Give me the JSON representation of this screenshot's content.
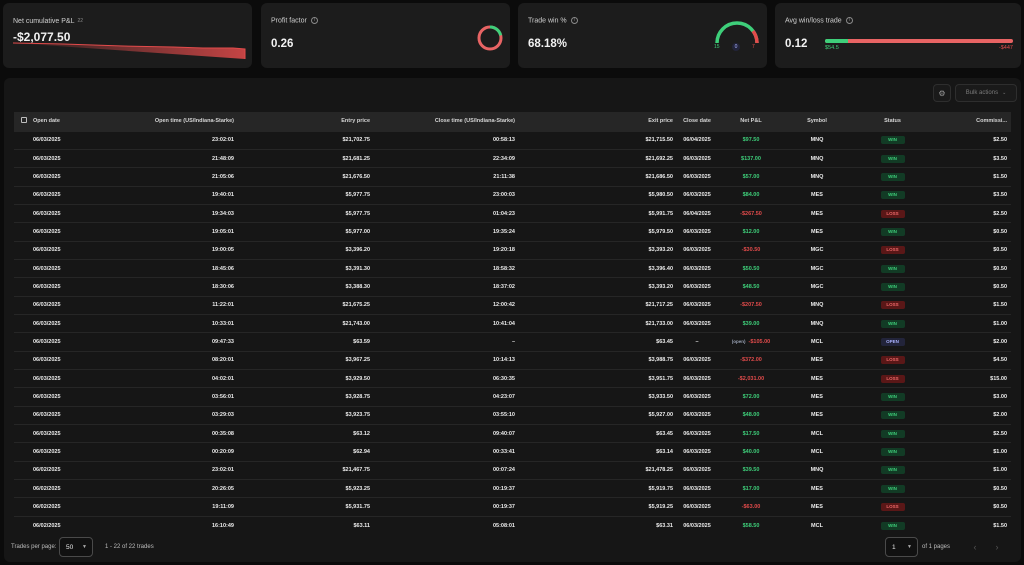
{
  "cards": {
    "net_pnl": {
      "label": "Net cumulative P&L",
      "count": "22",
      "value": "-$2,077.50"
    },
    "profit_factor": {
      "label": "Profit factor",
      "value": "0.26",
      "gauge_fraction": 0.21
    },
    "trade_win": {
      "label": "Trade win %",
      "value": "68.18%",
      "wins": "15",
      "breakeven": "0",
      "losses": "7"
    },
    "avg_win_loss": {
      "label": "Avg win/loss trade",
      "value": "0.12",
      "avg_win": "$54.5",
      "avg_loss": "-$447"
    }
  },
  "toolbar": {
    "bulk_actions": "Bulk actions",
    "settings_icon": "gear-icon"
  },
  "table": {
    "columns": [
      "Open date",
      "Open time (US/Indiana-Starke)",
      "Entry price",
      "Close time (US/Indiana-Starke)",
      "Exit price",
      "Close date",
      "Net P&L",
      "Symbol",
      "Status",
      "Commissi..."
    ],
    "rows": [
      {
        "open_date": "06/03/2025",
        "open_time": "23:02:01",
        "entry": "$21,702.75",
        "close_time": "00:58:13",
        "exit": "$21,715.50",
        "close_date": "06/04/2025",
        "pnl": "$97.50",
        "symbol": "MNQ",
        "status": "WIN",
        "comm": "$2.50"
      },
      {
        "open_date": "06/03/2025",
        "open_time": "21:48:09",
        "entry": "$21,681.25",
        "close_time": "22:34:09",
        "exit": "$21,692.25",
        "close_date": "06/03/2025",
        "pnl": "$137.00",
        "symbol": "MNQ",
        "status": "WIN",
        "comm": "$3.50"
      },
      {
        "open_date": "06/03/2025",
        "open_time": "21:05:06",
        "entry": "$21,676.50",
        "close_time": "21:11:38",
        "exit": "$21,686.50",
        "close_date": "06/03/2025",
        "pnl": "$57.00",
        "symbol": "MNQ",
        "status": "WIN",
        "comm": "$1.50"
      },
      {
        "open_date": "06/03/2025",
        "open_time": "19:40:01",
        "entry": "$5,977.75",
        "close_time": "23:00:03",
        "exit": "$5,980.50",
        "close_date": "06/03/2025",
        "pnl": "$84.00",
        "symbol": "MES",
        "status": "WIN",
        "comm": "$3.50"
      },
      {
        "open_date": "06/03/2025",
        "open_time": "19:34:03",
        "entry": "$5,977.75",
        "close_time": "01:04:23",
        "exit": "$5,991.75",
        "close_date": "06/04/2025",
        "pnl": "-$267.50",
        "symbol": "MES",
        "status": "LOSS",
        "comm": "$2.50"
      },
      {
        "open_date": "06/03/2025",
        "open_time": "19:05:01",
        "entry": "$5,977.00",
        "close_time": "19:35:24",
        "exit": "$5,979.50",
        "close_date": "06/03/2025",
        "pnl": "$12.00",
        "symbol": "MES",
        "status": "WIN",
        "comm": "$0.50"
      },
      {
        "open_date": "06/03/2025",
        "open_time": "19:00:05",
        "entry": "$3,396.20",
        "close_time": "19:20:18",
        "exit": "$3,393.20",
        "close_date": "06/03/2025",
        "pnl": "-$30.50",
        "symbol": "MGC",
        "status": "LOSS",
        "comm": "$0.50"
      },
      {
        "open_date": "06/03/2025",
        "open_time": "18:45:06",
        "entry": "$3,391.30",
        "close_time": "18:58:32",
        "exit": "$3,396.40",
        "close_date": "06/03/2025",
        "pnl": "$50.50",
        "symbol": "MGC",
        "status": "WIN",
        "comm": "$0.50"
      },
      {
        "open_date": "06/03/2025",
        "open_time": "18:30:06",
        "entry": "$3,388.30",
        "close_time": "18:37:02",
        "exit": "$3,393.20",
        "close_date": "06/03/2025",
        "pnl": "$48.50",
        "symbol": "MGC",
        "status": "WIN",
        "comm": "$0.50"
      },
      {
        "open_date": "06/03/2025",
        "open_time": "11:22:01",
        "entry": "$21,675.25",
        "close_time": "12:00:42",
        "exit": "$21,717.25",
        "close_date": "06/03/2025",
        "pnl": "-$207.50",
        "symbol": "MNQ",
        "status": "LOSS",
        "comm": "$1.50"
      },
      {
        "open_date": "06/03/2025",
        "open_time": "10:33:01",
        "entry": "$21,743.00",
        "close_time": "10:41:04",
        "exit": "$21,733.00",
        "close_date": "06/03/2025",
        "pnl": "$39.00",
        "symbol": "MNQ",
        "status": "WIN",
        "comm": "$1.00"
      },
      {
        "open_date": "06/03/2025",
        "open_time": "09:47:33",
        "entry": "$63.59",
        "close_time": "–",
        "exit": "$63.45",
        "close_date": "–",
        "pnl": "-$105.00",
        "pnl_prefix": "(open)",
        "symbol": "MCL",
        "status": "OPEN",
        "comm": "$2.00"
      },
      {
        "open_date": "06/03/2025",
        "open_time": "08:20:01",
        "entry": "$3,967.25",
        "close_time": "10:14:13",
        "exit": "$3,988.75",
        "close_date": "06/03/2025",
        "pnl": "-$372.00",
        "symbol": "MES",
        "status": "LOSS",
        "comm": "$4.50"
      },
      {
        "open_date": "06/03/2025",
        "open_time": "04:02:01",
        "entry": "$3,929.50",
        "close_time": "06:30:35",
        "exit": "$3,951.75",
        "close_date": "06/03/2025",
        "pnl": "-$2,031.00",
        "symbol": "MES",
        "status": "LOSS",
        "comm": "$15.00"
      },
      {
        "open_date": "06/03/2025",
        "open_time": "03:56:01",
        "entry": "$3,928.75",
        "close_time": "04:23:07",
        "exit": "$3,933.50",
        "close_date": "06/03/2025",
        "pnl": "$72.00",
        "symbol": "MES",
        "status": "WIN",
        "comm": "$3.00"
      },
      {
        "open_date": "06/03/2025",
        "open_time": "03:29:03",
        "entry": "$3,923.75",
        "close_time": "03:55:10",
        "exit": "$5,927.00",
        "close_date": "06/03/2025",
        "pnl": "$48.00",
        "symbol": "MES",
        "status": "WIN",
        "comm": "$2.00"
      },
      {
        "open_date": "06/03/2025",
        "open_time": "00:35:08",
        "entry": "$63.12",
        "close_time": "09:40:07",
        "exit": "$63.45",
        "close_date": "06/03/2025",
        "pnl": "$17.50",
        "symbol": "MCL",
        "status": "WIN",
        "comm": "$2.50"
      },
      {
        "open_date": "06/03/2025",
        "open_time": "00:20:09",
        "entry": "$62.94",
        "close_time": "00:33:41",
        "exit": "$63.14",
        "close_date": "06/03/2025",
        "pnl": "$40.00",
        "symbol": "MCL",
        "status": "WIN",
        "comm": "$1.00"
      },
      {
        "open_date": "06/02/2025",
        "open_time": "23:02:01",
        "entry": "$21,467.75",
        "close_time": "00:07:24",
        "exit": "$21,478.25",
        "close_date": "06/03/2025",
        "pnl": "$39.50",
        "symbol": "MNQ",
        "status": "WIN",
        "comm": "$1.00"
      },
      {
        "open_date": "06/02/2025",
        "open_time": "20:26:05",
        "entry": "$5,923.25",
        "close_time": "00:19:37",
        "exit": "$5,919.75",
        "close_date": "06/03/2025",
        "pnl": "$17.00",
        "symbol": "MES",
        "status": "WIN",
        "comm": "$0.50"
      },
      {
        "open_date": "06/02/2025",
        "open_time": "19:11:09",
        "entry": "$5,931.75",
        "close_time": "00:19:37",
        "exit": "$5,919.25",
        "close_date": "06/03/2025",
        "pnl": "-$63.00",
        "symbol": "MES",
        "status": "LOSS",
        "comm": "$0.50"
      },
      {
        "open_date": "06/02/2025",
        "open_time": "16:10:49",
        "entry": "$63.11",
        "close_time": "05:08:01",
        "exit": "$63.31",
        "close_date": "06/03/2025",
        "pnl": "$58.50",
        "symbol": "MCL",
        "status": "WIN",
        "comm": "$1.50"
      }
    ]
  },
  "footer": {
    "per_page_label": "Trades per page:",
    "per_page_value": "50",
    "range_text": "1 - 22 of 22 trades",
    "page_value": "1",
    "of_pages": "of 1 pages"
  },
  "colors": {
    "positive": "#3ecf7a",
    "negative": "#e24b4b",
    "background": "#0b0b0b",
    "card": "#1c1c1c"
  }
}
